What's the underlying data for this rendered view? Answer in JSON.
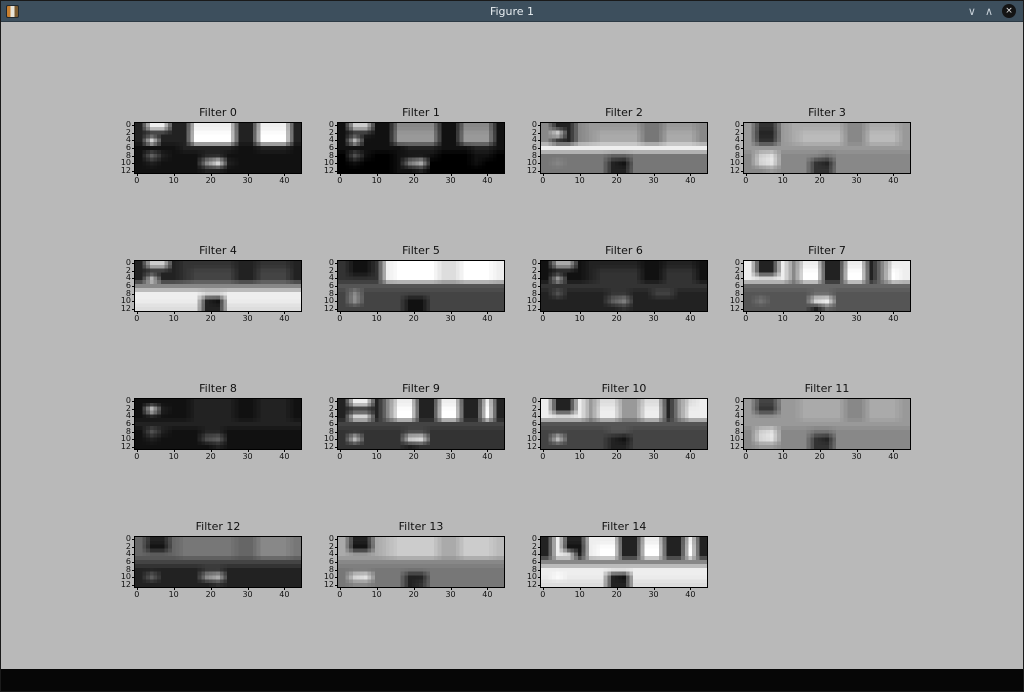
{
  "window": {
    "title": "Figure 1",
    "controls": {
      "shade": "∨",
      "maximize": "∧",
      "close": "×"
    },
    "titlebar_color": "#3d4f5d",
    "figure_background": "#b9b9b9"
  },
  "chart_data": {
    "type": "heatmap",
    "colormap": "gray",
    "x_ticks": [
      0,
      10,
      20,
      30,
      40
    ],
    "y_ticks": [
      0,
      2,
      4,
      6,
      8,
      10,
      12
    ],
    "x_range": [
      -0.5,
      44.5
    ],
    "y_range": [
      12.5,
      -0.5
    ],
    "grid": false,
    "layout": "4x4 grid, last row has 3 subplots",
    "subplots": [
      {
        "title": "Filter 0",
        "pixels_hex_rows": [
          "2ee22eeee22eee2",
          "22222ffff22fff2",
          "2e222ffff22fff2",
          "111122222112221",
          "162111221111111",
          "1211119e2111111",
          "111111221111111"
        ]
      },
      {
        "title": "Filter 1",
        "pixels_hex_rows": [
          "1cc118888118881",
          "122119999119991",
          "1c1119999119991",
          "111111222111221",
          "051001111000110",
          "0100018b0000100",
          "000001120000000"
        ]
      },
      {
        "title": "Filter 2",
        "pixels_hex_rows": [
          "822899999779998",
          "8e289aaaa77aaa8",
          "82289aaaa77aaa8",
          "eeeeeeeeeeeeeee",
          "777777667777777",
          "787777217777777",
          "777777227777777"
        ]
      },
      {
        "title": "Filter 3",
        "pixels_hex_rows": [
          "9339aaaaa88aaa9",
          "9229abbbb88bbb9",
          "9339abbbb88bbb9",
          "999999999999999",
          "8cd888878888888",
          "8de888328888888",
          "889888338888888"
        ]
      },
      {
        "title": "Filter 4",
        "pixels_hex_rows": [
          "2cc233333223332",
          "222234444224442",
          "2c2234444224442",
          "888888888888888",
          "eeeeeeddeeeeeee",
          "eeeeee21eeeeeee",
          "dddddd22ddddddd"
        ]
      },
      {
        "title": "Filter 5",
        "pixels_hex_rows": [
          "3113effffddfffe",
          "3113effffddfffe",
          "3333effffddfffe",
          "555555555555555",
          "484444444444444",
          "494444114444444",
          "444444114444444"
        ]
      },
      {
        "title": "Filter 6",
        "pixels_hex_rows": [
          "1aa122222112221",
          "111123333113331",
          "1a1123333113331",
          "333333333333333",
          "252222332244222",
          "222222682222222",
          "222222232222222"
        ]
      },
      {
        "title": "Filter 7",
        "pixels_hex_rows": [
          "e22e8ee22ee28ee",
          "e22e8ff22ff28fe",
          "eeee8ff22ff28fe",
          "666666666666666",
          "555555665555555",
          "575555ef5555555",
          "555555265555555"
        ]
      },
      {
        "title": "Filter 8",
        "pixels_hex_rows": [
          "111112222112221",
          "1d2112222112221",
          "111112222112221",
          "222222222222222",
          "152111221111111",
          "121111561111111",
          "111111121111111"
        ]
      },
      {
        "title": "Filter 9",
        "pixels_hex_rows": [
          "2ee28ee22ee22e2",
          "22228ff22ff22f2",
          "2ee28ff22ff22f2",
          "444444444444444",
          "333333443333333",
          "3c3333de3333333",
          "333333233333333"
        ]
      },
      {
        "title": "Filter 10",
        "pixels_hex_rows": [
          "e22e9dd99dd29de",
          "e22e9ee99ee29ee",
          "eeee9ee99ee29ee",
          "555555555555555",
          "444444554444444",
          "4c4444214444444",
          "444444224444444"
        ]
      },
      {
        "title": "Filter 11",
        "pixels_hex_rows": [
          "94499aaaa88aaa9",
          "93399aaaa88aaa9",
          "99999aaaa88aaa9",
          "999999999999999",
          "8cd888778888888",
          "8de888328888888",
          "899888338888888"
        ]
      },
      {
        "title": "Filter 12",
        "pixels_hex_rows": [
          "622677777668887",
          "611677777668887",
          "666677777668887",
          "444444444444444",
          "222222332222222",
          "2622229b2222222",
          "222222232222222"
        ]
      },
      {
        "title": "Filter 13",
        "pixels_hex_rows": [
          "a22abccccaacccb",
          "a11abccccaacccb",
          "aaaabccccaacccb",
          "888888888888888",
          "777777777777777",
          "7de777227777777",
          "788777237777777"
        ]
      },
      {
        "title": "Filter 14",
        "pixels_hex_rows": [
          "2e22eee22ee22e2",
          "2e11eff22ff22f2",
          "2ee2eff22ff22f2",
          "888888888888888",
          "eeeeeeeeeeeeeee",
          "efeeee21eeeeeee",
          "dddddd22ddddddd"
        ]
      }
    ]
  }
}
